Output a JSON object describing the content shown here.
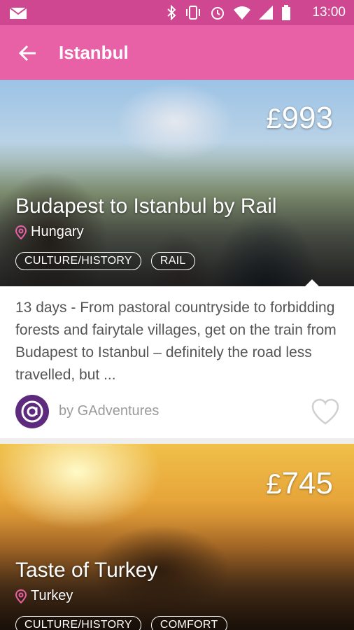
{
  "status_bar": {
    "time": "13:00"
  },
  "header": {
    "title": "Istanbul"
  },
  "trips": [
    {
      "price": "993",
      "currency": "£",
      "title": "Budapest to Istanbul by Rail",
      "location": "Hungary",
      "tags": [
        "CULTURE/HISTORY",
        "RAIL"
      ],
      "description": "13 days - From pastoral countryside to forbidding forests and fairytale villages, get on the train from Budapest to Istanbul – definitely the road less travelled, but ...",
      "operator": "by GAdventures"
    },
    {
      "price": "745",
      "currency": "£",
      "title": "Taste of Turkey",
      "location": "Turkey",
      "tags": [
        "CULTURE/HISTORY",
        "COMFORT"
      ]
    }
  ],
  "colors": {
    "status_bar": "#cf4790",
    "app_bar": "#e860a6",
    "accent": "#e860a6",
    "operator_logo": "#5d2a7e"
  }
}
